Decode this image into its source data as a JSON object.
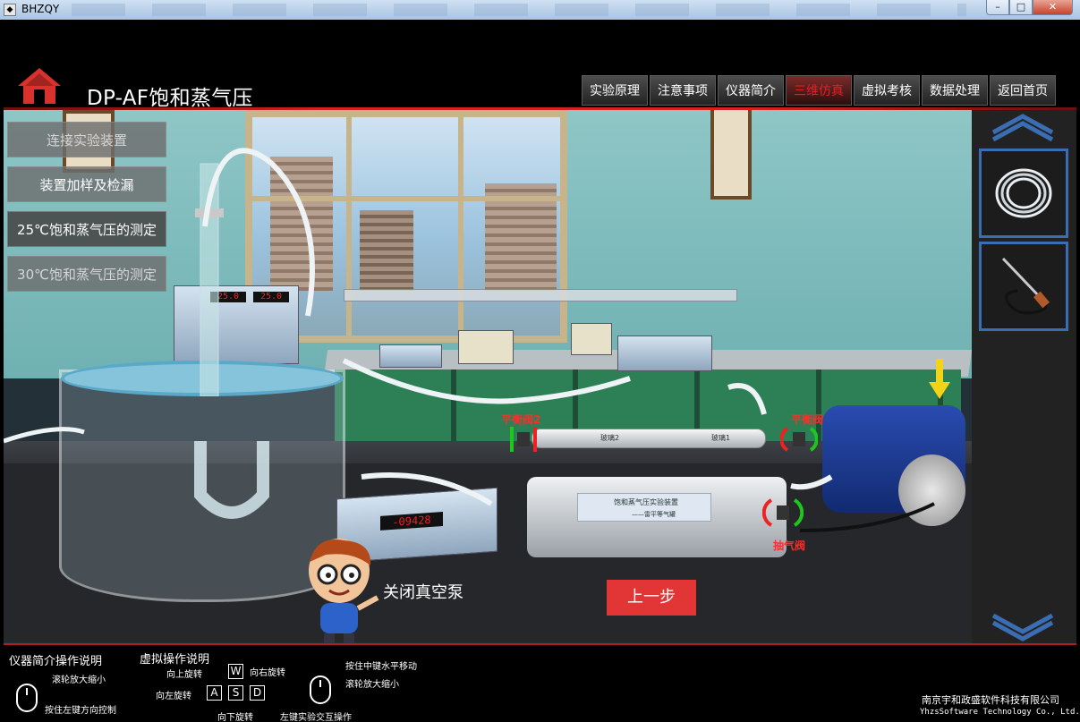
{
  "window": {
    "title": "BHZQY",
    "icon": "app-icon",
    "controls": {
      "minimize": "–",
      "maximize": "□",
      "close": "✕"
    }
  },
  "header": {
    "title": "DP-AF饱和蒸气压",
    "home_icon": "home-icon",
    "nav": [
      {
        "label": "实验原理",
        "active": false
      },
      {
        "label": "注意事项",
        "active": false
      },
      {
        "label": "仪器简介",
        "active": false
      },
      {
        "label": "三维仿真",
        "active": true
      },
      {
        "label": "虚拟考核",
        "active": false
      },
      {
        "label": "数据处理",
        "active": false
      },
      {
        "label": "返回首页",
        "active": false
      }
    ]
  },
  "steps": [
    {
      "label": "连接实验装置",
      "state": "muted"
    },
    {
      "label": "装置加样及检漏",
      "state": "normal"
    },
    {
      "label": "25℃饱和蒸气压的测定",
      "state": "current"
    },
    {
      "label": "30℃饱和蒸气压的测定",
      "state": "muted"
    }
  ],
  "scene": {
    "valve_labels": {
      "balance_valve_2": "平衡阀2",
      "balance_valve_1": "平衡阀1",
      "exhaust_valve": "抽气阀"
    },
    "thermostat_display_left": "25.0",
    "thermostat_display_right": "25.0",
    "pressure_display": "-09428",
    "apparatus_panel_title": "饱和蒸气压实验装置",
    "apparatus_panel_sub": "——雷平等气罐",
    "tube_tag_left": "玻璃2",
    "tube_tag_right": "玻璃1",
    "instruction_text": "关闭真空泵",
    "prev_button": "上一步"
  },
  "right_panel": {
    "scroll_up": "chevron-up-icon",
    "scroll_down": "chevron-down-icon",
    "tools": [
      "tubing-coil-icon",
      "temperature-probe-icon"
    ]
  },
  "footer": {
    "instrument_help_title": "仪器简介操作说明",
    "instrument_wheel": "滚轮放大缩小",
    "instrument_left_drag": "按住左键方向控制",
    "virtual_help_title": "虚拟操作说明",
    "rotate_up": "向上旋转",
    "rotate_right": "向右旋转",
    "rotate_left": "向左旋转",
    "rotate_down": "向下旋转",
    "key_w": "W",
    "key_a": "A",
    "key_s": "S",
    "key_d": "D",
    "middle_drag": "按住中键水平移动",
    "wheel_zoom": "滚轮放大缩小",
    "left_click_interact": "左键实验交互操作",
    "company_cn": "南京宇和政盛软件科技有限公司",
    "company_en": "YhzsSoftware Technology Co., Ltd."
  }
}
